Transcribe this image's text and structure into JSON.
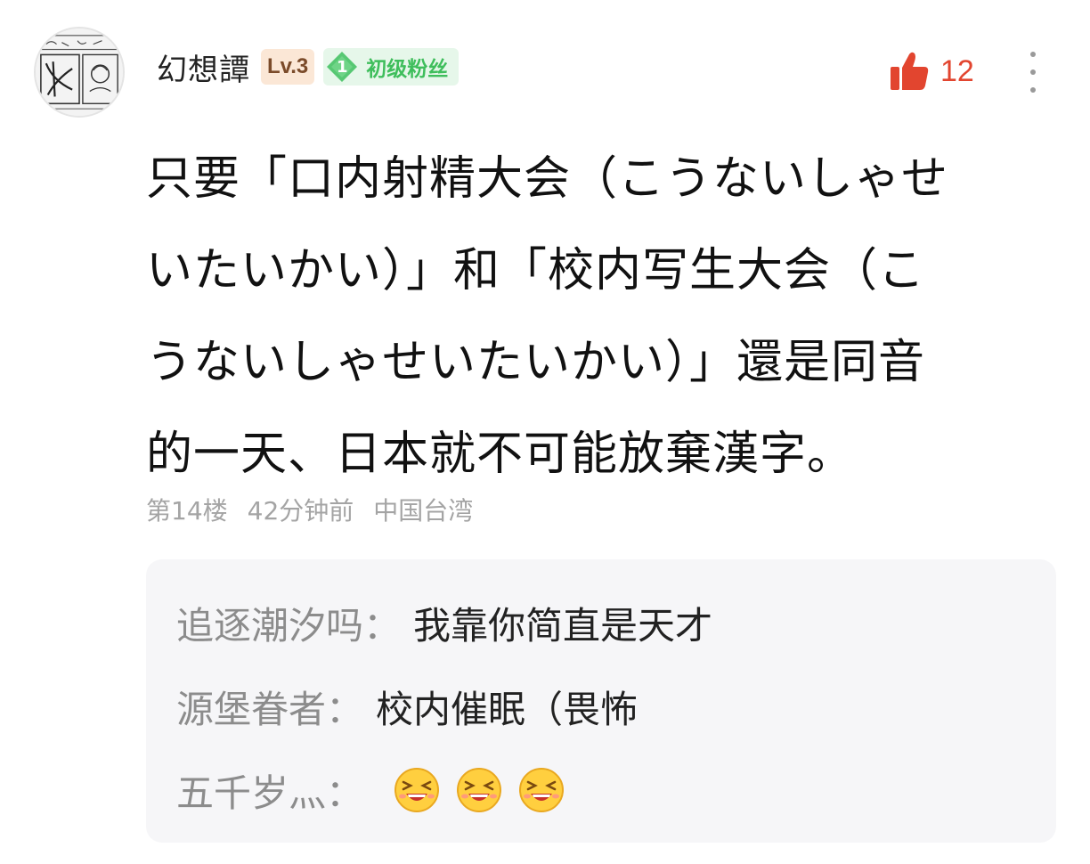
{
  "comment": {
    "username": "幻想譚",
    "level": "Lv.3",
    "fan_badge": {
      "level": "1",
      "title": "初级粉丝"
    },
    "likes": "12",
    "body_lines": [
      "只要「口内射精大会（こうないしゃせ",
      "いたいかい）」和「校内写生大会（こ",
      "うないしゃせいたいかい）」還是同音",
      "的一天、日本就不可能放棄漢字。"
    ],
    "floor": "第14楼",
    "time": "42分钟前",
    "location": "中国台湾"
  },
  "replies": [
    {
      "name": "追逐潮汐吗",
      "separator": "：",
      "text": "我靠你简直是天才"
    },
    {
      "name": "源堡眷者",
      "separator": "：",
      "text": "校内催眠（畏怖"
    },
    {
      "name": "五千岁灬",
      "separator": "：",
      "emojis": [
        "laughing-emoji",
        "laughing-emoji",
        "laughing-emoji"
      ]
    }
  ],
  "colors": {
    "like_red": "#e2452f",
    "fan_green": "#3fbe5c",
    "level_bg": "#fbe7d6",
    "meta_gray": "#a4a4a4"
  },
  "icons": [
    "avatar-sketch",
    "thumbs-up-icon",
    "more-vertical-icon",
    "fan-diamond-icon",
    "laughing-emoji"
  ]
}
